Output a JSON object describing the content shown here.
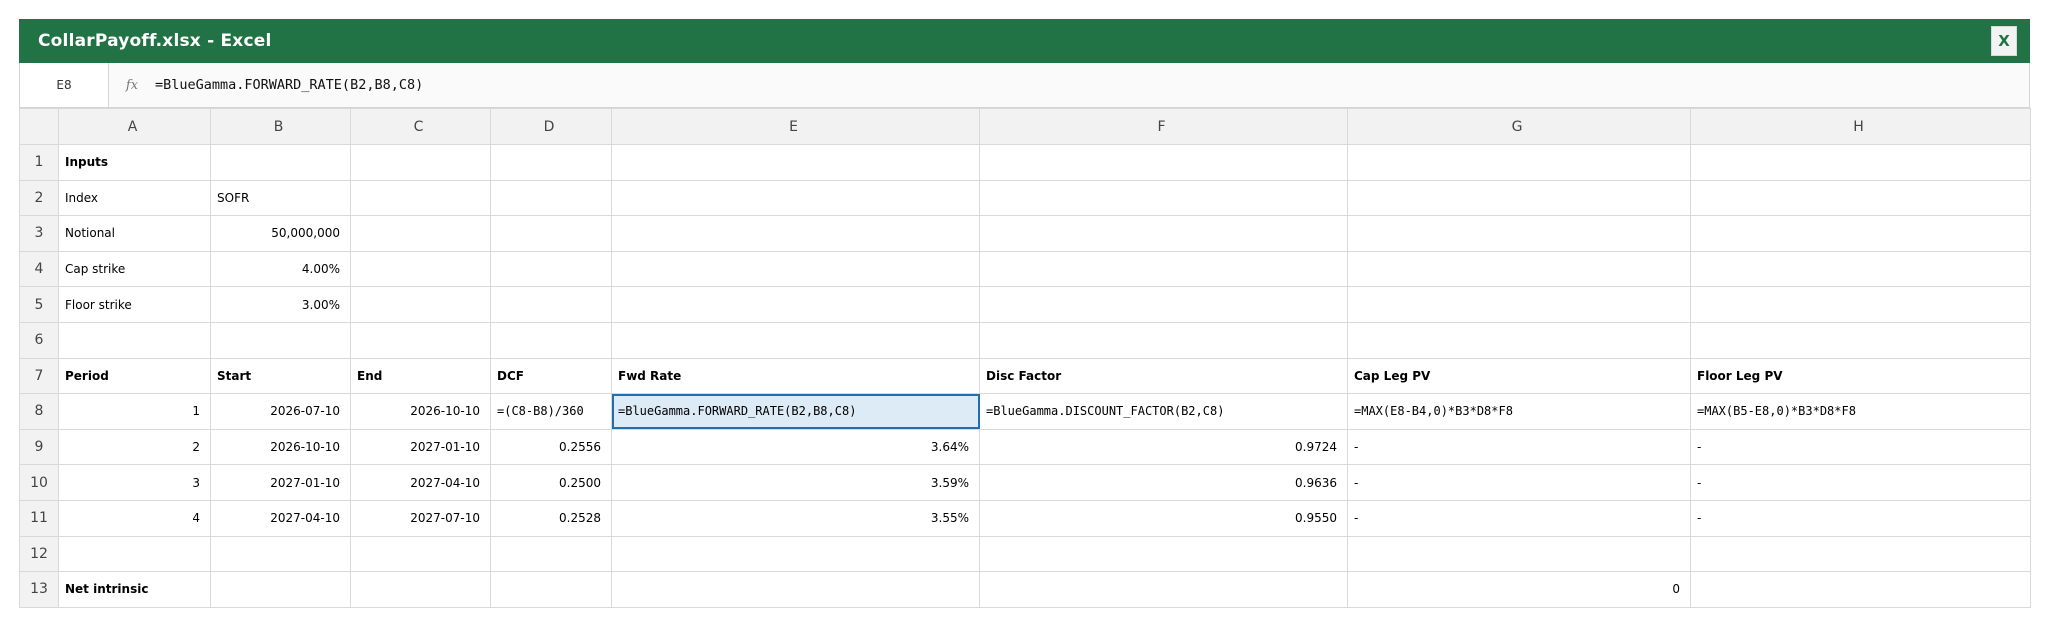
{
  "window": {
    "title": "CollarPayoff.xlsx - Excel",
    "close_label": "X"
  },
  "formula_bar": {
    "name_box": "E8",
    "fx_label": "fx",
    "formula": "=BlueGamma.FORWARD_RATE(B2,B8,C8)"
  },
  "columns": [
    "A",
    "B",
    "C",
    "D",
    "E",
    "F",
    "G",
    "H"
  ],
  "rows": [
    {
      "num": "1",
      "cells": [
        "Inputs",
        "",
        "",
        "",
        "",
        "",
        "",
        ""
      ]
    },
    {
      "num": "2",
      "cells": [
        "Index",
        "SOFR",
        "",
        "",
        "",
        "",
        "",
        ""
      ]
    },
    {
      "num": "3",
      "cells": [
        "Notional",
        "50,000,000",
        "",
        "",
        "",
        "",
        "",
        ""
      ]
    },
    {
      "num": "4",
      "cells": [
        "Cap strike",
        "4.00%",
        "",
        "",
        "",
        "",
        "",
        ""
      ]
    },
    {
      "num": "5",
      "cells": [
        "Floor strike",
        "3.00%",
        "",
        "",
        "",
        "",
        "",
        ""
      ]
    },
    {
      "num": "6",
      "cells": [
        "",
        "",
        "",
        "",
        "",
        "",
        "",
        ""
      ]
    },
    {
      "num": "7",
      "cells": [
        "Period",
        "Start",
        "End",
        "DCF",
        "Fwd Rate",
        "Disc Factor",
        "Cap Leg PV",
        "Floor Leg PV"
      ]
    },
    {
      "num": "8",
      "cells": [
        "1",
        "2026-07-10",
        "2026-10-10",
        "=(C8-B8)/360",
        "=BlueGamma.FORWARD_RATE(B2,B8,C8)",
        "=BlueGamma.DISCOUNT_FACTOR(B2,C8)",
        "=MAX(E8-B4,0)*B3*D8*F8",
        "=MAX(B5-E8,0)*B3*D8*F8"
      ]
    },
    {
      "num": "9",
      "cells": [
        "2",
        "2026-10-10",
        "2027-01-10",
        "0.2556",
        "3.64%",
        "0.9724",
        "-",
        "-"
      ]
    },
    {
      "num": "10",
      "cells": [
        "3",
        "2027-01-10",
        "2027-04-10",
        "0.2500",
        "3.59%",
        "0.9636",
        "-",
        "-"
      ]
    },
    {
      "num": "11",
      "cells": [
        "4",
        "2027-04-10",
        "2027-07-10",
        "0.2528",
        "3.55%",
        "0.9550",
        "-",
        "-"
      ]
    },
    {
      "num": "12",
      "cells": [
        "",
        "",
        "",
        "",
        "",
        "",
        "",
        ""
      ]
    },
    {
      "num": "13",
      "cells": [
        "Net intrinsic",
        "",
        "",
        "",
        "",
        "",
        "0",
        ""
      ]
    }
  ],
  "colors": {
    "titlebar": "#217346",
    "selection_border": "#1f6fb2",
    "selection_fill": "#ddebf7"
  }
}
